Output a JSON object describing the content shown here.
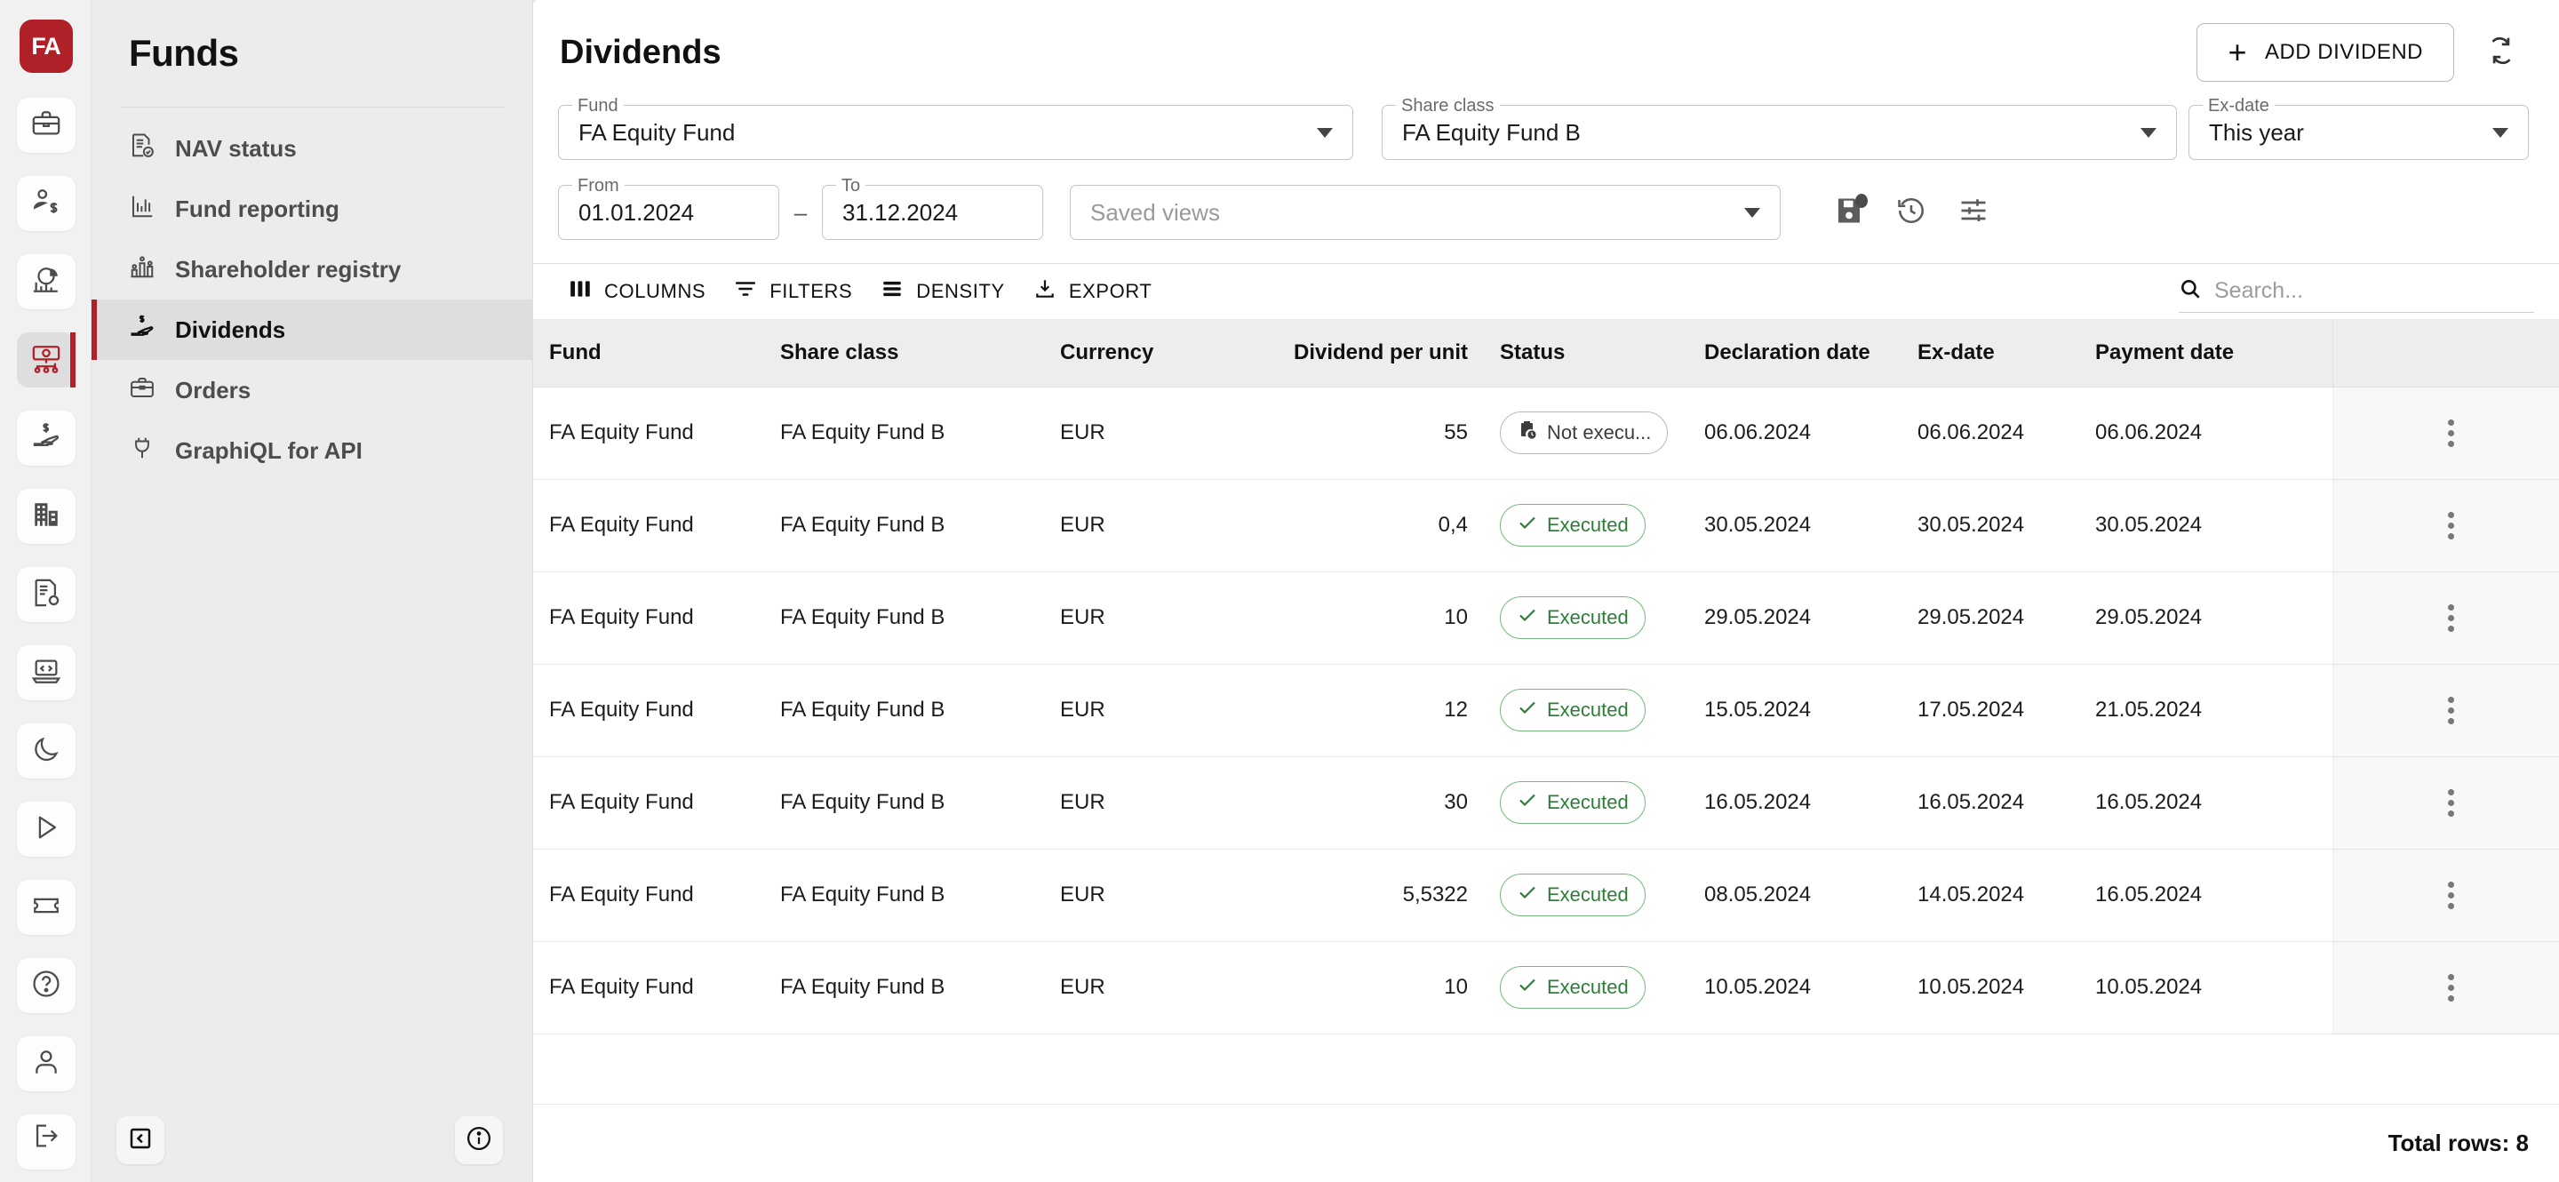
{
  "brand": {
    "logo_text": "FA",
    "accent_color": "#b02028"
  },
  "rail": {
    "items": [
      {
        "name": "briefcase-icon",
        "active": false
      },
      {
        "name": "client-money-icon",
        "active": false
      },
      {
        "name": "analytics-chart-icon",
        "active": false
      },
      {
        "name": "funds-money-icon",
        "active": true
      },
      {
        "name": "dividend-hand-icon",
        "active": false
      },
      {
        "name": "company-building-icon",
        "active": false
      },
      {
        "name": "document-settings-icon",
        "active": false
      },
      {
        "name": "code-laptop-icon",
        "active": false
      },
      {
        "name": "dark-mode-moon-icon",
        "active": false
      },
      {
        "name": "play-icon",
        "active": false
      },
      {
        "name": "ticket-icon",
        "active": false
      },
      {
        "name": "help-question-icon",
        "active": false
      },
      {
        "name": "user-profile-icon",
        "active": false
      },
      {
        "name": "logout-icon",
        "active": false
      }
    ]
  },
  "nav": {
    "title": "Funds",
    "items": [
      {
        "label": "NAV status",
        "icon": "nav-status-icon",
        "active": false
      },
      {
        "label": "Fund reporting",
        "icon": "bar-chart-icon",
        "active": false
      },
      {
        "label": "Shareholder registry",
        "icon": "shareholder-registry-icon",
        "active": false
      },
      {
        "label": "Dividends",
        "icon": "dividend-hand-icon",
        "active": true
      },
      {
        "label": "Orders",
        "icon": "briefcase-icon",
        "active": false
      },
      {
        "label": "GraphiQL for API",
        "icon": "plug-icon",
        "active": false
      }
    ],
    "collapse_icon": "collapse-left-icon",
    "info_icon": "info-circle-icon"
  },
  "header": {
    "title": "Dividends",
    "add_button": "ADD DIVIDEND",
    "add_icon": "plus-icon",
    "refresh_icon": "refresh-sync-icon"
  },
  "filters": {
    "fund": {
      "legend": "Fund",
      "value": "FA Equity Fund"
    },
    "share_class": {
      "legend": "Share class",
      "value": "FA Equity Fund B"
    },
    "ex_date": {
      "legend": "Ex-date",
      "value": "This year"
    },
    "from": {
      "legend": "From",
      "value": "01.01.2024"
    },
    "to": {
      "legend": "To",
      "value": "31.12.2024"
    },
    "range_separator": "–",
    "saved_views": {
      "placeholder": "Saved views"
    },
    "action_icons": [
      {
        "name": "save-view-icon",
        "badge": true
      },
      {
        "name": "view-history-icon",
        "badge": false
      },
      {
        "name": "view-settings-icon",
        "badge": false
      }
    ]
  },
  "grid_toolbar": {
    "columns": "COLUMNS",
    "filters": "FILTERS",
    "density": "DENSITY",
    "export": "EXPORT",
    "search_placeholder": "Search..."
  },
  "table": {
    "columns": [
      "Fund",
      "Share class",
      "Currency",
      "Dividend per unit",
      "Status",
      "Declaration date",
      "Ex-date",
      "Payment date"
    ],
    "rows": [
      {
        "fund": "FA Equity Fund",
        "share_class": "FA Equity Fund B",
        "currency": "EUR",
        "dividend_per_unit": "55",
        "status": "Not execu...",
        "status_kind": "pending",
        "declaration_date": "06.06.2024",
        "ex_date": "06.06.2024",
        "payment_date": "06.06.2024"
      },
      {
        "fund": "FA Equity Fund",
        "share_class": "FA Equity Fund B",
        "currency": "EUR",
        "dividend_per_unit": "0,4",
        "status": "Executed",
        "status_kind": "executed",
        "declaration_date": "30.05.2024",
        "ex_date": "30.05.2024",
        "payment_date": "30.05.2024"
      },
      {
        "fund": "FA Equity Fund",
        "share_class": "FA Equity Fund B",
        "currency": "EUR",
        "dividend_per_unit": "10",
        "status": "Executed",
        "status_kind": "executed",
        "declaration_date": "29.05.2024",
        "ex_date": "29.05.2024",
        "payment_date": "29.05.2024"
      },
      {
        "fund": "FA Equity Fund",
        "share_class": "FA Equity Fund B",
        "currency": "EUR",
        "dividend_per_unit": "12",
        "status": "Executed",
        "status_kind": "executed",
        "declaration_date": "15.05.2024",
        "ex_date": "17.05.2024",
        "payment_date": "21.05.2024"
      },
      {
        "fund": "FA Equity Fund",
        "share_class": "FA Equity Fund B",
        "currency": "EUR",
        "dividend_per_unit": "30",
        "status": "Executed",
        "status_kind": "executed",
        "declaration_date": "16.05.2024",
        "ex_date": "16.05.2024",
        "payment_date": "16.05.2024"
      },
      {
        "fund": "FA Equity Fund",
        "share_class": "FA Equity Fund B",
        "currency": "EUR",
        "dividend_per_unit": "5,5322",
        "status": "Executed",
        "status_kind": "executed",
        "declaration_date": "08.05.2024",
        "ex_date": "14.05.2024",
        "payment_date": "16.05.2024"
      },
      {
        "fund": "FA Equity Fund",
        "share_class": "FA Equity Fund B",
        "currency": "EUR",
        "dividend_per_unit": "10",
        "status": "Executed",
        "status_kind": "executed",
        "declaration_date": "10.05.2024",
        "ex_date": "10.05.2024",
        "payment_date": "10.05.2024"
      }
    ],
    "row_action_icon": "kebab-menu-icon",
    "total_rows": "Total rows: 8"
  },
  "colors": {
    "executed_green": "#2e7d39",
    "pending_gray": "#3c3c3c",
    "brand_red": "#b02028"
  }
}
